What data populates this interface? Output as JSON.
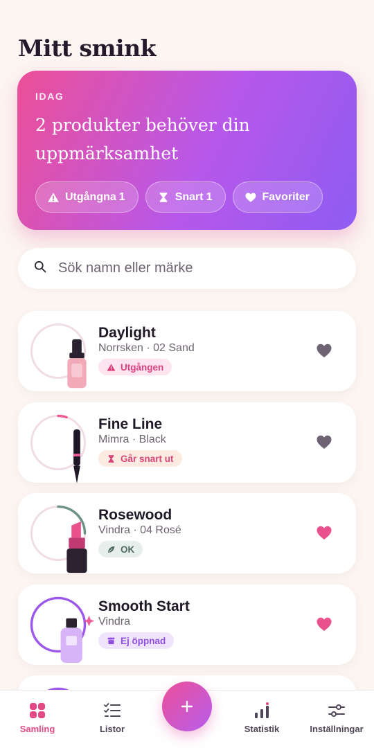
{
  "header": {
    "title": "Mitt smink"
  },
  "hero": {
    "eyebrow": "IDAG",
    "headline": "2 produkter behöver din uppmärksamhet",
    "chips": [
      {
        "label": "Utgångna",
        "count": "1",
        "icon": "warning-icon"
      },
      {
        "label": "Snart",
        "count": "1",
        "icon": "hourglass-icon"
      },
      {
        "label": "Favoriter",
        "icon": "heart-icon"
      }
    ]
  },
  "search": {
    "placeholder": "Sök namn eller märke",
    "value": ""
  },
  "products": [
    {
      "name": "Daylight",
      "meta": "Norrsken · 02 Sand",
      "status": "Utgången",
      "status_type": "expired",
      "status_icon": "warning-icon",
      "favorite": false,
      "icon": "foundation-bottle-icon",
      "ring_color": "#efdde3",
      "progress": 0.0
    },
    {
      "name": "Fine Line",
      "meta": "Mimra · Black",
      "status": "Går snart ut",
      "status_type": "soon",
      "status_icon": "hourglass-icon",
      "favorite": false,
      "icon": "eyeliner-icon",
      "ring_color": "#ec5b95",
      "progress": 0.05
    },
    {
      "name": "Rosewood",
      "meta": "Vindra · 04 Rosé",
      "status": "OK",
      "status_type": "ok",
      "status_icon": "leaf-icon",
      "favorite": true,
      "icon": "lipstick-icon",
      "ring_color": "#6c9186",
      "progress": 0.25
    },
    {
      "name": "Smooth Start",
      "meta": "Vindra",
      "status": "Ej öppnad",
      "status_type": "unopened",
      "status_icon": "jar-icon",
      "favorite": true,
      "icon": "primer-bottle-icon",
      "ring_color": "#9b58ea",
      "progress": 1.0
    }
  ],
  "bottom_nav": {
    "items": [
      {
        "label": "Samling",
        "icon": "grid-icon",
        "active": true
      },
      {
        "label": "Listor",
        "icon": "checklist-icon",
        "active": false
      },
      {
        "label": "Statistik",
        "icon": "bar-chart-icon",
        "active": false
      },
      {
        "label": "Inställningar",
        "icon": "sliders-icon",
        "active": false
      }
    ],
    "fab": {
      "icon": "plus-icon"
    }
  },
  "colors": {
    "accent_pink": "#e24985",
    "accent_purple": "#9b58ea",
    "background": "#fcf5f1",
    "favorite_on": "#e8518b",
    "favorite_off": "#6d6373"
  }
}
